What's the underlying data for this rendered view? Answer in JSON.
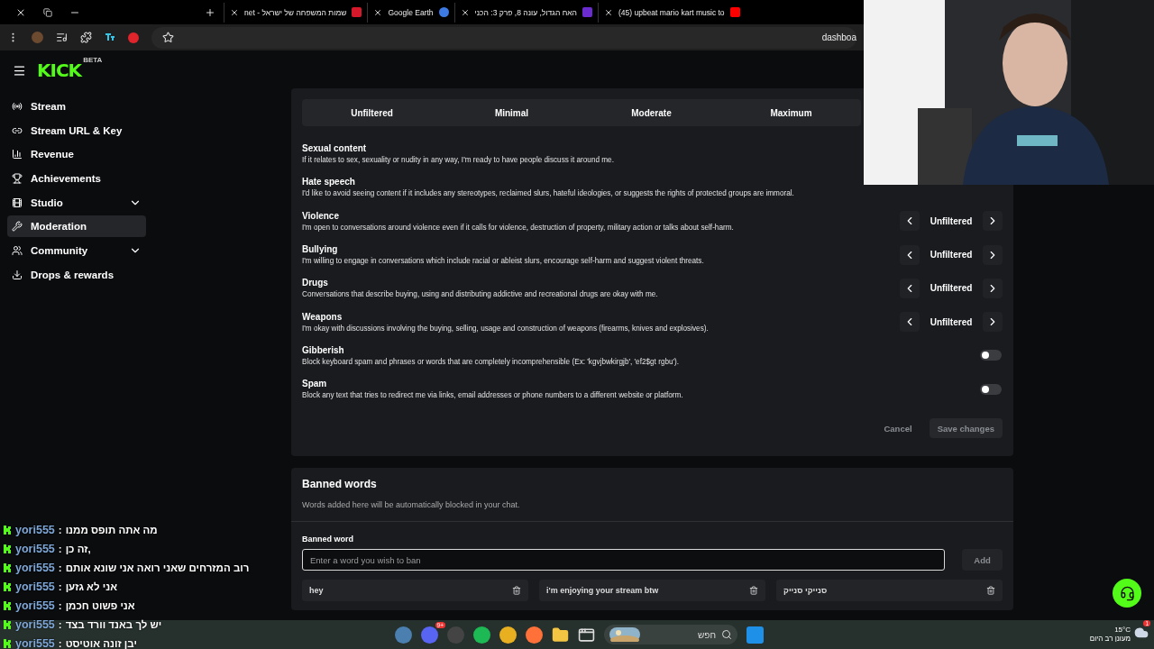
{
  "browser": {
    "tabs": [
      {
        "title": "שמות המשפחה של ישראל - net"
      },
      {
        "title": "Google Earth"
      },
      {
        "title": "האח הגדול, עונה 8, פרק 3: הכני"
      },
      {
        "title": "(45) upbeat mario kart music to"
      }
    ],
    "address": "dashboa"
  },
  "sidebar": {
    "logo": "KICK",
    "logo_badge": "BETA",
    "items": [
      {
        "label": "Stream",
        "selected": false,
        "expandable": false
      },
      {
        "label": "Stream URL & Key",
        "selected": false,
        "expandable": false
      },
      {
        "label": "Revenue",
        "selected": false,
        "expandable": false
      },
      {
        "label": "Achievements",
        "selected": false,
        "expandable": false
      },
      {
        "label": "Studio",
        "selected": false,
        "expandable": true
      },
      {
        "label": "Moderation",
        "selected": true,
        "expandable": false
      },
      {
        "label": "Community",
        "selected": false,
        "expandable": true
      },
      {
        "label": "Drops & rewards",
        "selected": false,
        "expandable": false
      }
    ]
  },
  "filter_card": {
    "levels": [
      {
        "label": "Unfiltered",
        "selected": false
      },
      {
        "label": "Minimal",
        "selected": false
      },
      {
        "label": "Moderate",
        "selected": false
      },
      {
        "label": "Maximum",
        "selected": false
      }
    ],
    "categories": [
      {
        "kind": "text",
        "title": "Sexual content",
        "description": "If it relates to sex, sexuality or nudity in any way, I'm ready to have people discuss it around me."
      },
      {
        "kind": "text",
        "title": "Hate speech",
        "description": "I'd like to avoid seeing content if it includes any stereotypes, reclaimed slurs, hateful ideologies, or suggests the rights of protected groups are immoral."
      },
      {
        "kind": "selector",
        "title": "Violence",
        "description": "I'm open to conversations around violence even if it calls for violence, destruction of property, military action or talks about self-harm.",
        "value": "Unfiltered"
      },
      {
        "kind": "selector",
        "title": "Bullying",
        "description": "I'm willing to engage in conversations which include racial or ableist slurs, encourage self-harm and suggest violent threats.",
        "value": "Unfiltered"
      },
      {
        "kind": "selector",
        "title": "Drugs",
        "description": "Conversations that describe buying, using and distributing addictive and recreational drugs are okay with me.",
        "value": "Unfiltered"
      },
      {
        "kind": "selector",
        "title": "Weapons",
        "description": "I'm okay with discussions involving the buying, selling, usage and construction of weapons (firearms, knives and explosives).",
        "value": "Unfiltered"
      },
      {
        "kind": "toggle",
        "title": "Gibberish",
        "description": "Block keyboard spam and phrases or words that are completely incomprehensible (Ex: 'kgvjbwkirgjb', 'ef2$gt rgbu').",
        "on": false
      },
      {
        "kind": "toggle",
        "title": "Spam",
        "description": "Block any text that tries to redirect me via links, email addresses or phone numbers to a different website or platform.",
        "on": false
      }
    ],
    "buttons": [
      {
        "label": "Cancel",
        "kind": "plain",
        "disabled": true
      },
      {
        "label": "Save changes",
        "kind": "filled",
        "disabled": true
      }
    ]
  },
  "banned_words": {
    "title": "Banned words",
    "subtitle": "Words added here will be automatically blocked in your chat.",
    "field_label": "Banned word",
    "placeholder": "Enter a word you wish to ban",
    "add_button": {
      "label": "Add",
      "disabled": true
    },
    "words": [
      "hey",
      "i'm enjoying your stream btw",
      "סנייקי סנייק"
    ]
  },
  "chat_overlay": [
    {
      "user": "yori555",
      "separator": ":",
      "message": "מה אתה תופס ממנו"
    },
    {
      "user": "yori555",
      "separator": ":",
      "message": ",זה כן"
    },
    {
      "user": "yori555",
      "separator": ":",
      "message": "רוב המזרחים שאני רואה אני שונא אותם"
    },
    {
      "user": "yori555",
      "separator": ":",
      "message": "אני לא גזען"
    },
    {
      "user": "yori555",
      "separator": ":",
      "message": "אני פשוט חכמן"
    },
    {
      "user": "yori555",
      "separator": ":",
      "message": "יש לך באנד וורד בצד"
    },
    {
      "user": "yori555",
      "separator": ":",
      "message": "יבן זונה אוטיסט"
    }
  ],
  "taskbar": {
    "discord_badge": "9+",
    "search_placeholder": "חפש",
    "temperature": "15°C",
    "weather": "מעונן רב היום",
    "weather_badge": "1"
  }
}
